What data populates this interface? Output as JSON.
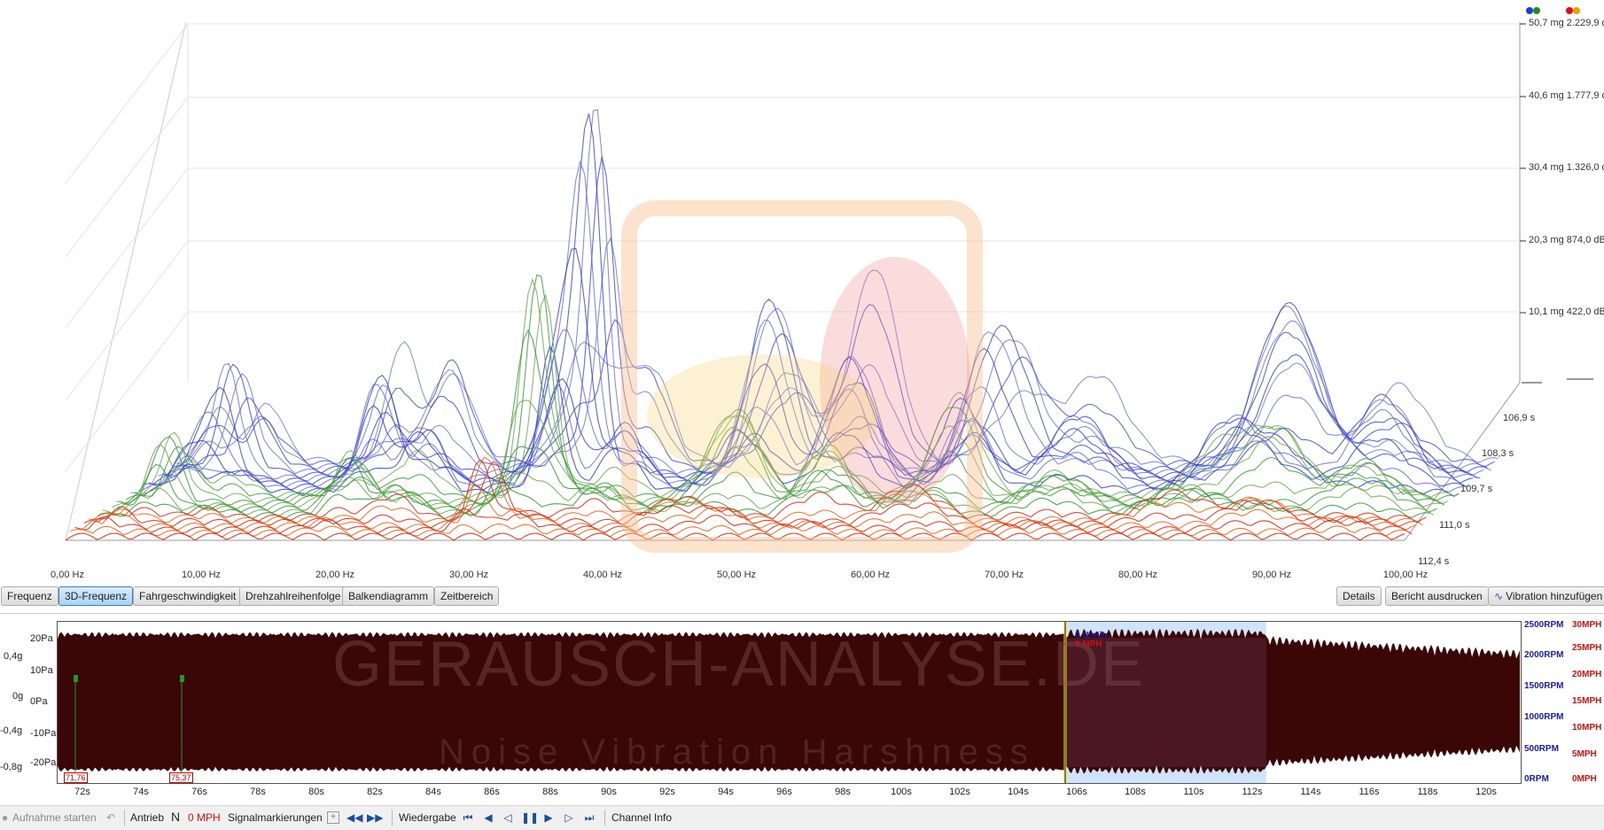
{
  "chart_3d": {
    "x_ticks": [
      "0,00 Hz",
      "10,00 Hz",
      "20,00 Hz",
      "30,00 Hz",
      "40,00 Hz",
      "50,00 Hz",
      "60,00 Hz",
      "70,00 Hz",
      "80,00 Hz",
      "90,00 Hz",
      "100,00 Hz"
    ],
    "z_ticks": [
      "106,9 s",
      "108,3 s",
      "109,7 s",
      "111,0 s",
      "112,4 s"
    ],
    "right_ticks": [
      "50,7 mg 2.229,9 d",
      "40,6 mg 1.777,9 d",
      "30,4 mg 1.326,0 d",
      "20,3 mg 874,0 dB",
      "10,1 mg 422,0 dB"
    ],
    "legend_dots": [
      "#1a3fcc",
      "#1f8a2a",
      "#e01010",
      "#f0a000"
    ]
  },
  "tabs": {
    "frequenz": "Frequenz",
    "frequenz3d": "3D-Frequenz",
    "fahrgeschwindigkeit": "Fahrgeschwindigkeit",
    "drehzahlreihenfolge": "Drehzahlreihenfolge",
    "balkendiagramm": "Balkendiagramm",
    "zeitbereich": "Zeitbereich",
    "details": "Details",
    "bericht": "Bericht ausdrucken",
    "vibration": "Vibration hinzufügen"
  },
  "waveform": {
    "left_pa": [
      "20Pa",
      "10Pa",
      "0Pa",
      "-10Pa",
      "-20Pa"
    ],
    "left_g": [
      "0,4g",
      "0g",
      "-0,4g",
      "-0,8g"
    ],
    "right_rpm": [
      "2500RPM",
      "2000RPM",
      "1500RPM",
      "1000RPM",
      "500RPM",
      "0RPM"
    ],
    "right_mph": [
      "30MPH",
      "25MPH",
      "20MPH",
      "15MPH",
      "10MPH",
      "5MPH",
      "0MPH"
    ],
    "x_ticks": [
      "72s",
      "74s",
      "76s",
      "78s",
      "80s",
      "82s",
      "84s",
      "86s",
      "88s",
      "90s",
      "92s",
      "94s",
      "96s",
      "98s",
      "100s",
      "102s",
      "104s",
      "106s",
      "108s",
      "110s",
      "112s",
      "114s",
      "116s",
      "118s",
      "120s"
    ],
    "markers": [
      "71,76",
      "75,37"
    ],
    "cursor_rpm": "0 U/min",
    "cursor_mph": "0 MPH",
    "watermark_title": "GERAUSCH-ANALYSE.DE",
    "watermark_sub": "Noise  Vibration  Harshness"
  },
  "status": {
    "aufnahme": "Aufnahme starten",
    "antrieb": "Antrieb",
    "gear": "N",
    "speed": "0 MPH",
    "signalmarkierungen": "Signalmarkierungen",
    "wiedergabe": "Wiedergabe",
    "channel_info": "Channel Info"
  },
  "colors": {
    "accent_blue": "#1a3fcc",
    "accent_green": "#1f8a2a",
    "accent_red": "#e01010",
    "wave_fill": "#3a0606",
    "selection": "#cfe4f8"
  }
}
